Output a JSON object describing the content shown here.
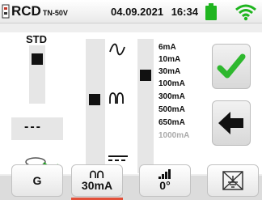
{
  "header": {
    "title": "RCD",
    "subtitle": "TN-50V",
    "date": "04.09.2021",
    "time": "16:34",
    "battery_color": "#1fb51f",
    "wifi_color": "#1fb51f"
  },
  "mode": {
    "label": "STD",
    "dashes": "---"
  },
  "waveforms": {
    "dc_symbol": "==="
  },
  "current_options": [
    "6mA",
    "10mA",
    "30mA",
    "100mA",
    "300mA",
    "500mA",
    "650mA",
    "1000mA"
  ],
  "selected_current": "30mA",
  "actions": {
    "confirm_color": "#2eb82e",
    "back_color": "#111111"
  },
  "toolbar": {
    "g_label": "G",
    "current_label": "30mA",
    "angle_label": "0°"
  },
  "accent_color": "#e2503a"
}
